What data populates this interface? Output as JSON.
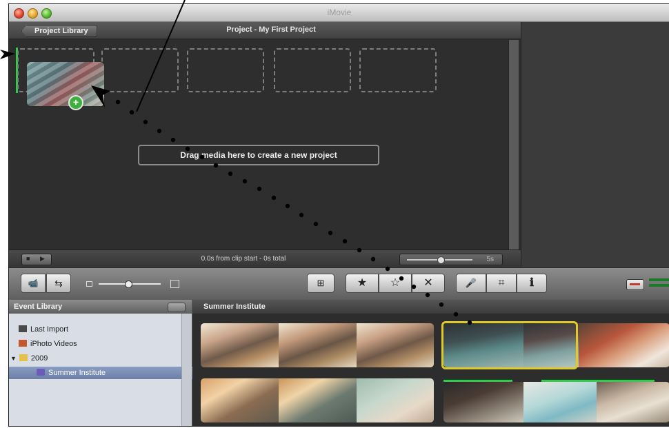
{
  "window": {
    "title": "iMovie"
  },
  "project": {
    "back_label": "Project Library",
    "title": "Project - My First Project",
    "drop_message": "Drag media here to create a new project",
    "time_text": "0.0s from clip start - 0s total",
    "zoom_value": "5s"
  },
  "toolbar": {
    "buttons": [
      {
        "name": "import-camera-button",
        "glyph": "📹"
      },
      {
        "name": "swap-events-button",
        "glyph": "⇆"
      },
      {
        "name": "add-to-project-button",
        "glyph": "⊞"
      },
      {
        "name": "mark-favorite-button",
        "glyph": "★"
      },
      {
        "name": "unmark-button",
        "glyph": "☆"
      },
      {
        "name": "reject-button",
        "glyph": "✕"
      },
      {
        "name": "voiceover-button",
        "glyph": "🎤"
      },
      {
        "name": "crop-button",
        "glyph": "⌗"
      },
      {
        "name": "inspector-button",
        "glyph": "ℹ"
      }
    ]
  },
  "event_library": {
    "header": "Event Library",
    "items": [
      {
        "label": "Last Import",
        "icon": "film-icon"
      },
      {
        "label": "iPhoto Videos",
        "icon": "iphoto-icon"
      },
      {
        "label": "2009",
        "icon": "folder-icon"
      },
      {
        "label": "Summer Institute",
        "icon": "star-event-icon"
      }
    ]
  },
  "events": {
    "header": "Summer Institute"
  },
  "colors": {
    "accent_green": "#2fce4a",
    "selection_yellow": "#e0c92a"
  }
}
